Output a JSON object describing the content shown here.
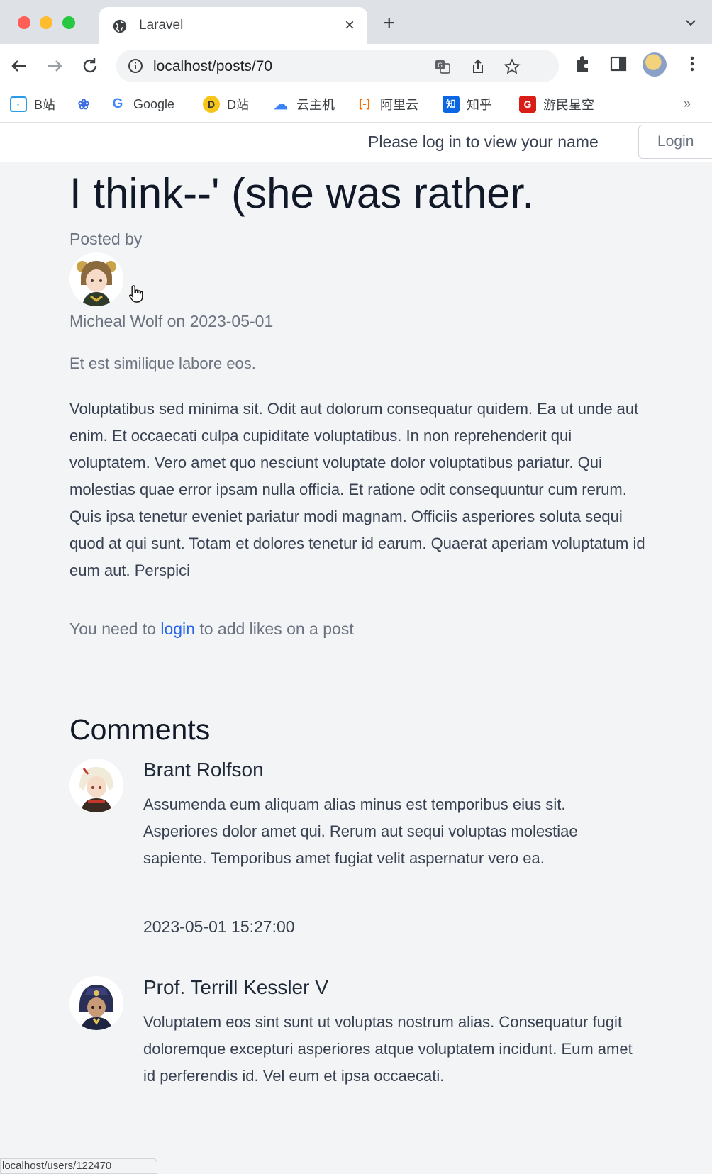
{
  "browser": {
    "tab_title": "Laravel",
    "url": "localhost/posts/70",
    "bookmarks": [
      "B站",
      "Google",
      "D站",
      "云主机",
      "阿里云",
      "知乎",
      "游民星空"
    ],
    "bookmarks_more": "»"
  },
  "header": {
    "login_message": "Please log in to view your name",
    "login_button": "Login"
  },
  "post": {
    "title": "I think--' (she was rather.",
    "posted_by_label": "Posted by",
    "author_line": "Micheal Wolf on 2023-05-01",
    "excerpt": "Et est similique labore eos.",
    "body": "Voluptatibus sed minima sit. Odit aut dolorum consequatur quidem. Ea ut unde aut enim. Et occaecati culpa cupiditate voluptatibus. In non reprehenderit qui voluptatem. Vero amet quo nesciunt voluptate dolor voluptatibus pariatur. Qui molestias quae error ipsam nulla officia. Et ratione odit consequuntur cum rerum. Quis ipsa tenetur eveniet pariatur modi magnam. Officiis asperiores soluta sequi quod at qui sunt. Totam et dolores tenetur id earum. Quaerat aperiam voluptatum id eum aut. Perspici",
    "likes_prefix": "You need to",
    "likes_link": "login",
    "likes_suffix": "to add likes on a post"
  },
  "comments": {
    "heading": "Comments",
    "items": [
      {
        "name": "Brant Rolfson",
        "body": "Assumenda eum aliquam alias minus est temporibus eius sit. Asperiores dolor amet qui. Rerum aut sequi voluptas molestiae sapiente. Temporibus amet fugiat velit aspernatur vero ea.",
        "date": "2023-05-01 15:27:00"
      },
      {
        "name": "Prof. Terrill Kessler V",
        "body": "Voluptatem eos sint sunt ut voluptas nostrum alias. Consequatur fugit doloremque excepturi asperiores atque voluptatem incidunt. Eum amet id perferendis id. Vel eum et ipsa occaecati."
      }
    ]
  },
  "status_bar": "localhost/users/122470"
}
